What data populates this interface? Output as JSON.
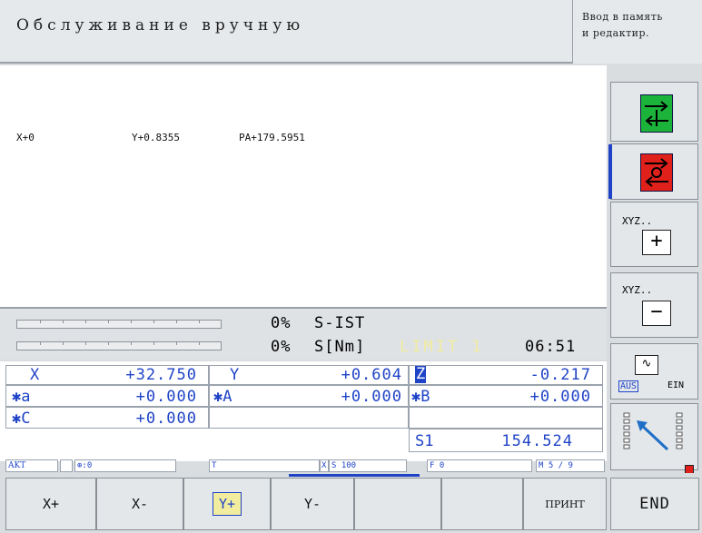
{
  "header": {
    "mode_title": "Обслуживание вручную",
    "program_mode_line1": "Ввод в память",
    "program_mode_line2": "и редактир."
  },
  "main": {
    "positions": [
      "X+0",
      "Y+0.8355",
      "PA+179.5951"
    ]
  },
  "status": {
    "s_ist_pct": "0%",
    "s_ist_label": "S-IST",
    "s_nm_pct": "0%",
    "s_nm_label": "S[Nm]",
    "limit": "LIMIT 1",
    "time": "06:51"
  },
  "axes": {
    "x_label": "X",
    "x_val": "+32.750",
    "y_label": "Y",
    "y_val": "+0.604",
    "z_label": "Z",
    "z_val": "-0.217",
    "a_label": "a",
    "a_val": "+0.000",
    "A_label": "A",
    "A_val": "+0.000",
    "B_label": "B",
    "B_val": "+0.000",
    "C_label": "C",
    "C_val": "+0.000",
    "s1_label": "S1",
    "s1_val": "154.524"
  },
  "status_bar": {
    "akt": "AKT",
    "tool_axis": ":0",
    "t": "T",
    "xs": "X",
    "s": "S 100",
    "f": "F 0",
    "m": "M 5 / 9"
  },
  "sidebar": {
    "xyz_plus_label": "XYZ..",
    "xyz_minus_label": "XYZ..",
    "aus": "AUS",
    "ein": "EIN"
  },
  "softkeys": {
    "x_plus": "X+",
    "x_minus": "X-",
    "y_plus": "Y+",
    "y_minus": "Y-",
    "print": "ПРИНТ",
    "end": "END"
  },
  "colors": {
    "value_blue": "#1f43c7",
    "limit_yellow": "#f1ec9e",
    "green": "#1bb33a",
    "red": "#e0201a"
  }
}
